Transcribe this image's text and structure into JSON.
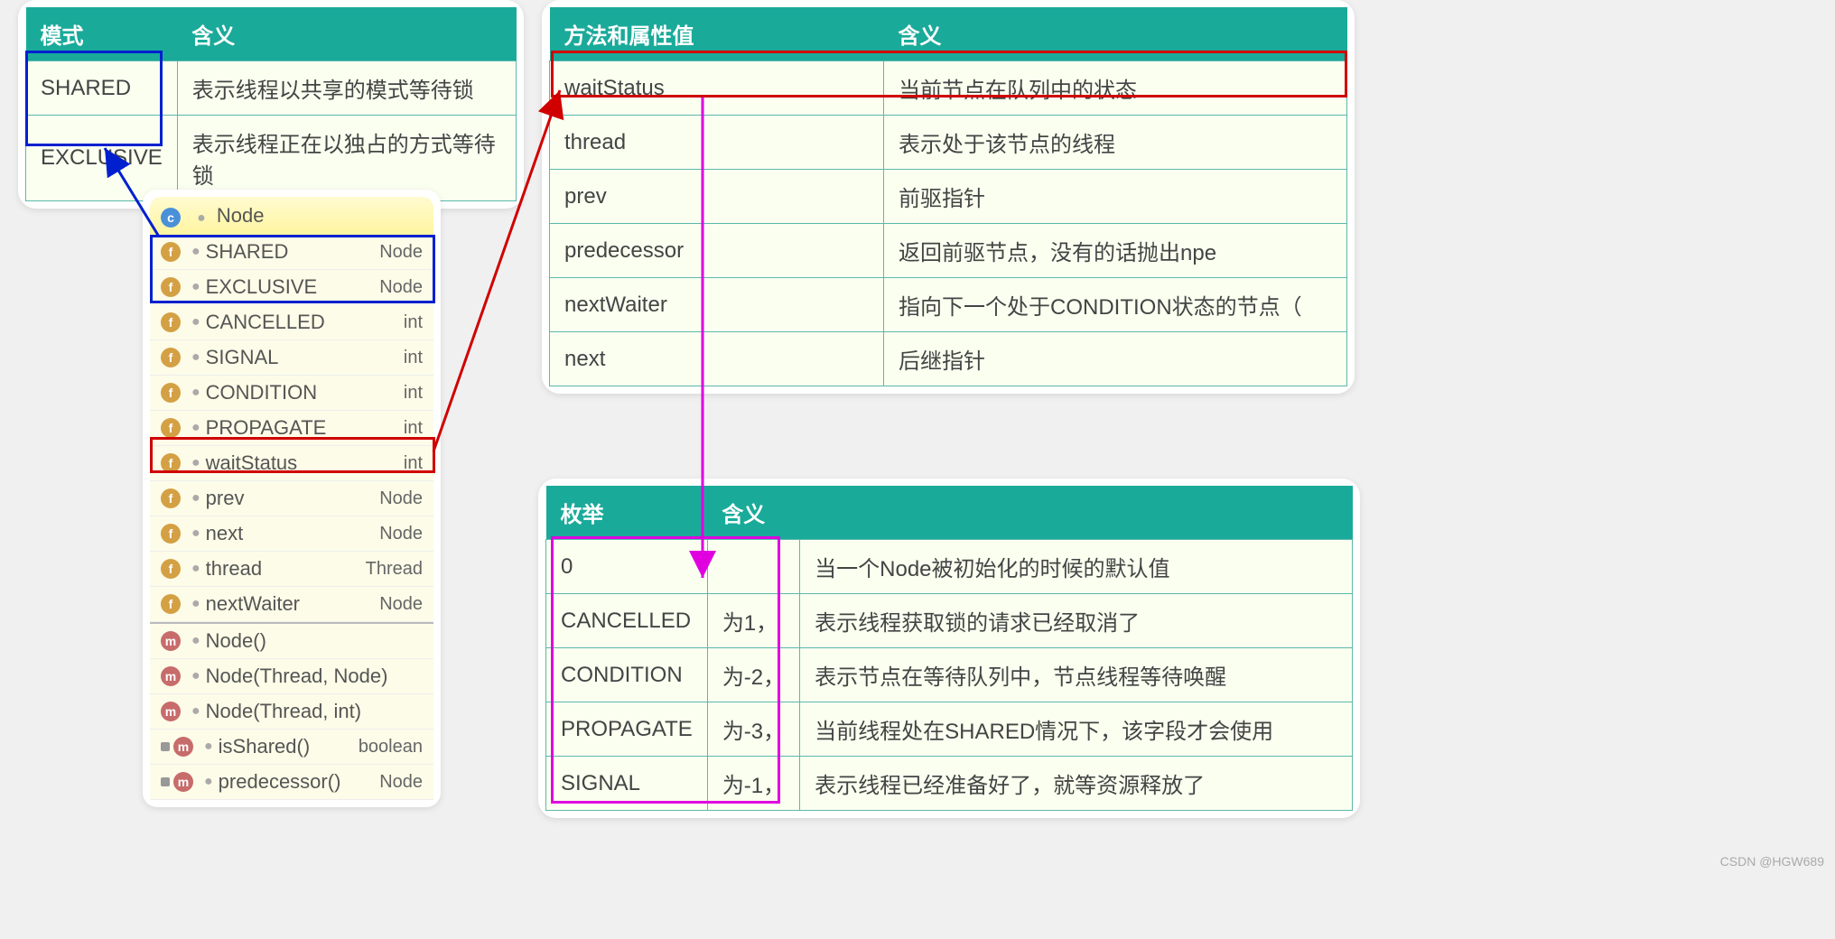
{
  "mode_table": {
    "headers": [
      "模式",
      "含义"
    ],
    "rows": [
      {
        "mode": "SHARED",
        "meaning": "表示线程以共享的模式等待锁"
      },
      {
        "mode": "EXCLUSIVE",
        "meaning": "表示线程正在以独占的方式等待锁"
      }
    ]
  },
  "node_class": {
    "name": "Node",
    "fields": [
      {
        "icon": "sf",
        "name": "SHARED",
        "type": "Node"
      },
      {
        "icon": "sf",
        "name": "EXCLUSIVE",
        "type": "Node"
      },
      {
        "icon": "sf",
        "name": "CANCELLED",
        "type": "int"
      },
      {
        "icon": "sf",
        "name": "SIGNAL",
        "type": "int"
      },
      {
        "icon": "sf",
        "name": "CONDITION",
        "type": "int"
      },
      {
        "icon": "sf",
        "name": "PROPAGATE",
        "type": "int"
      },
      {
        "icon": "f",
        "name": "waitStatus",
        "type": "int"
      },
      {
        "icon": "f",
        "name": "prev",
        "type": "Node"
      },
      {
        "icon": "f",
        "name": "next",
        "type": "Node"
      },
      {
        "icon": "f",
        "name": "thread",
        "type": "Thread"
      },
      {
        "icon": "f",
        "name": "nextWaiter",
        "type": "Node"
      }
    ],
    "methods": [
      {
        "icon": "m",
        "name": "Node()",
        "type": ""
      },
      {
        "icon": "m",
        "name": "Node(Thread, Node)",
        "type": ""
      },
      {
        "icon": "m",
        "name": "Node(Thread, int)",
        "type": ""
      },
      {
        "icon": "m",
        "lock": true,
        "name": "isShared()",
        "type": "boolean"
      },
      {
        "icon": "m",
        "lock": true,
        "name": "predecessor()",
        "type": "Node"
      }
    ]
  },
  "methods_table": {
    "headers": [
      "方法和属性值",
      "含义"
    ],
    "rows": [
      {
        "name": "waitStatus",
        "meaning": "当前节点在队列中的状态"
      },
      {
        "name": "thread",
        "meaning": "表示处于该节点的线程"
      },
      {
        "name": "prev",
        "meaning": "前驱指针"
      },
      {
        "name": "predecessor",
        "meaning": "返回前驱节点，没有的话抛出npe"
      },
      {
        "name": "nextWaiter",
        "meaning": "指向下一个处于CONDITION状态的节点（"
      },
      {
        "name": "next",
        "meaning": "后继指针"
      }
    ]
  },
  "enum_table": {
    "headers": [
      "枚举",
      "含义"
    ],
    "rows": [
      {
        "name": "0",
        "val": "",
        "meaning": "当一个Node被初始化的时候的默认值"
      },
      {
        "name": "CANCELLED",
        "val": "为1，",
        "meaning": "表示线程获取锁的请求已经取消了"
      },
      {
        "name": "CONDITION",
        "val": "为-2，",
        "meaning": "表示节点在等待队列中，节点线程等待唤醒"
      },
      {
        "name": "PROPAGATE",
        "val": "为-3，",
        "meaning": "当前线程处在SHARED情况下，该字段才会使用"
      },
      {
        "name": "SIGNAL",
        "val": "为-1，",
        "meaning": "表示线程已经准备好了，就等资源释放了"
      }
    ]
  },
  "watermark": "CSDN @HGW689"
}
